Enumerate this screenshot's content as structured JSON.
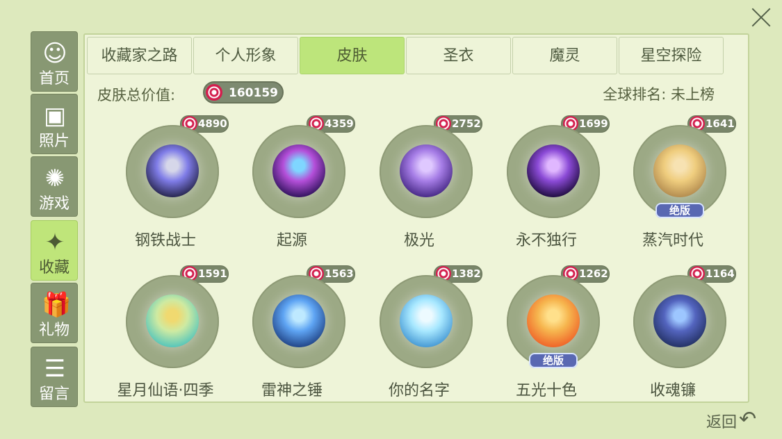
{
  "sidebar": {
    "items": [
      {
        "label": "首页",
        "icon": "profile-icon",
        "active": false
      },
      {
        "label": "照片",
        "icon": "photo-icon",
        "active": false
      },
      {
        "label": "游戏",
        "icon": "atom-icon",
        "active": false
      },
      {
        "label": "收藏",
        "icon": "collection-icon",
        "active": true
      },
      {
        "label": "礼物",
        "icon": "gift-icon",
        "active": false
      },
      {
        "label": "留言",
        "icon": "message-icon",
        "active": false
      }
    ]
  },
  "tabs": [
    {
      "label": "收藏家之路",
      "active": false
    },
    {
      "label": "个人形象",
      "active": false
    },
    {
      "label": "皮肤",
      "active": true
    },
    {
      "label": "圣衣",
      "active": false
    },
    {
      "label": "魔灵",
      "active": false
    },
    {
      "label": "星空探险",
      "active": false
    }
  ],
  "summary": {
    "label": "皮肤总价值:",
    "value": "160159",
    "rank": "全球排名: 未上榜"
  },
  "items": [
    {
      "name": "钢铁战士",
      "price": "4890",
      "colors": [
        "#2d2b58",
        "#7f7ce7",
        "#d6d7e9"
      ],
      "limited": false
    },
    {
      "name": "起源",
      "price": "4359",
      "colors": [
        "#3a1766",
        "#b44fd9",
        "#7fd6ff"
      ],
      "limited": false
    },
    {
      "name": "极光",
      "price": "2752",
      "colors": [
        "#4d2e8c",
        "#a67de6",
        "#dfc8ff"
      ],
      "limited": false
    },
    {
      "name": "永不独行",
      "price": "1699",
      "colors": [
        "#27104a",
        "#8b4ad6",
        "#e0b7ff"
      ],
      "limited": false
    },
    {
      "name": "蒸汽时代",
      "price": "1641",
      "colors": [
        "#b79052",
        "#efcd7e",
        "#f7e2b2"
      ],
      "limited": true
    },
    {
      "name": "星月仙语·四季",
      "price": "1591",
      "colors": [
        "#5cc8b9",
        "#ceeaa2",
        "#f0d970"
      ],
      "limited": false
    },
    {
      "name": "雷神之锤",
      "price": "1563",
      "colors": [
        "#254b8e",
        "#5ea4f3",
        "#bee9ff"
      ],
      "limited": false
    },
    {
      "name": "你的名字",
      "price": "1382",
      "colors": [
        "#4c9ed7",
        "#a8e8ff",
        "#edfaff"
      ],
      "limited": false
    },
    {
      "name": "五光十色",
      "price": "1262",
      "colors": [
        "#f0692b",
        "#f6b54e",
        "#ffe08b"
      ],
      "limited": true
    },
    {
      "name": "收魂镰",
      "price": "1164",
      "colors": [
        "#27356b",
        "#5364be",
        "#9dc6ff"
      ],
      "limited": false
    }
  ],
  "limited_label": "绝版",
  "back_label": "返回"
}
